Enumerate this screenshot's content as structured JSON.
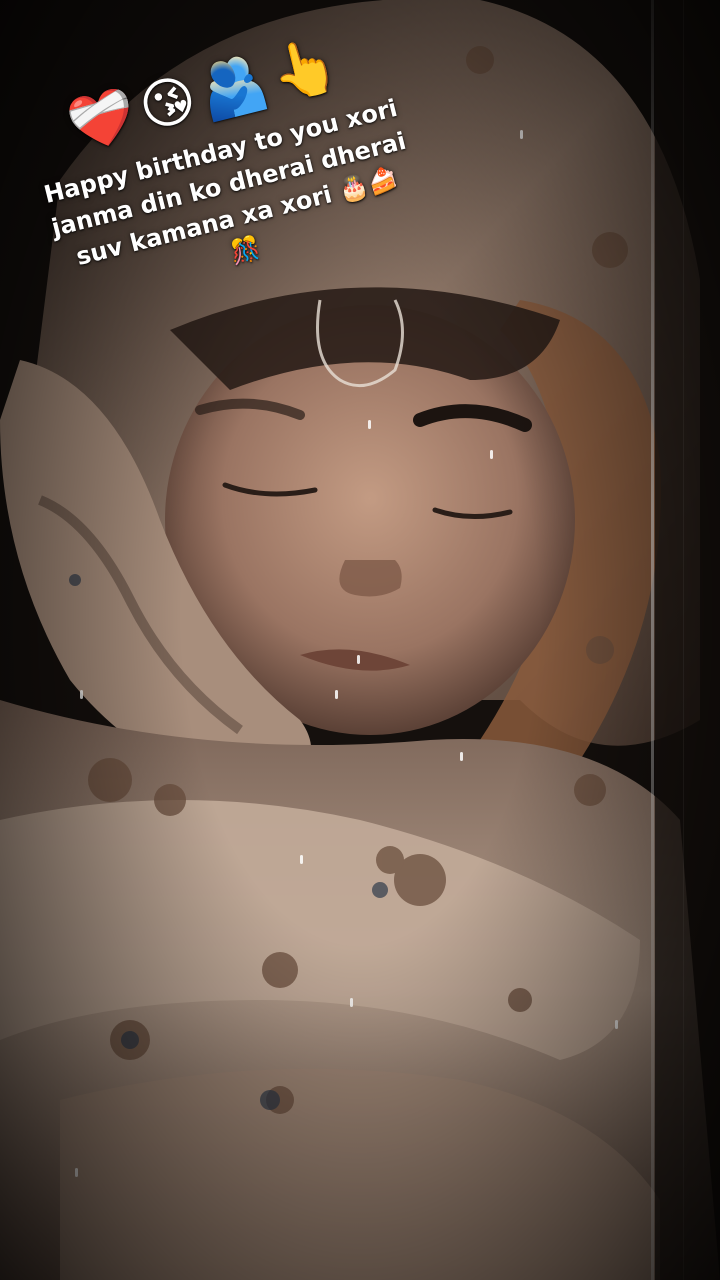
{
  "overlay": {
    "emoji_row": "❤️‍🩹😘🫂👆",
    "lines": [
      "Happy birthday to you xori",
      "janma din ko dherai dherai",
      "suv kamana xa xori"
    ],
    "line3_emojis": "🎂🍰",
    "last_emoji": "🎊"
  },
  "scene": {
    "subject": "sleeping child wrapped in patterned blanket",
    "palette": {
      "background": "#15100d",
      "blanket": "#c9b3a2",
      "blanket_shadow": "#5e4a3f",
      "skin": "#b08a74",
      "skin_shadow": "#5a4035",
      "hair": "#1c1410"
    }
  }
}
